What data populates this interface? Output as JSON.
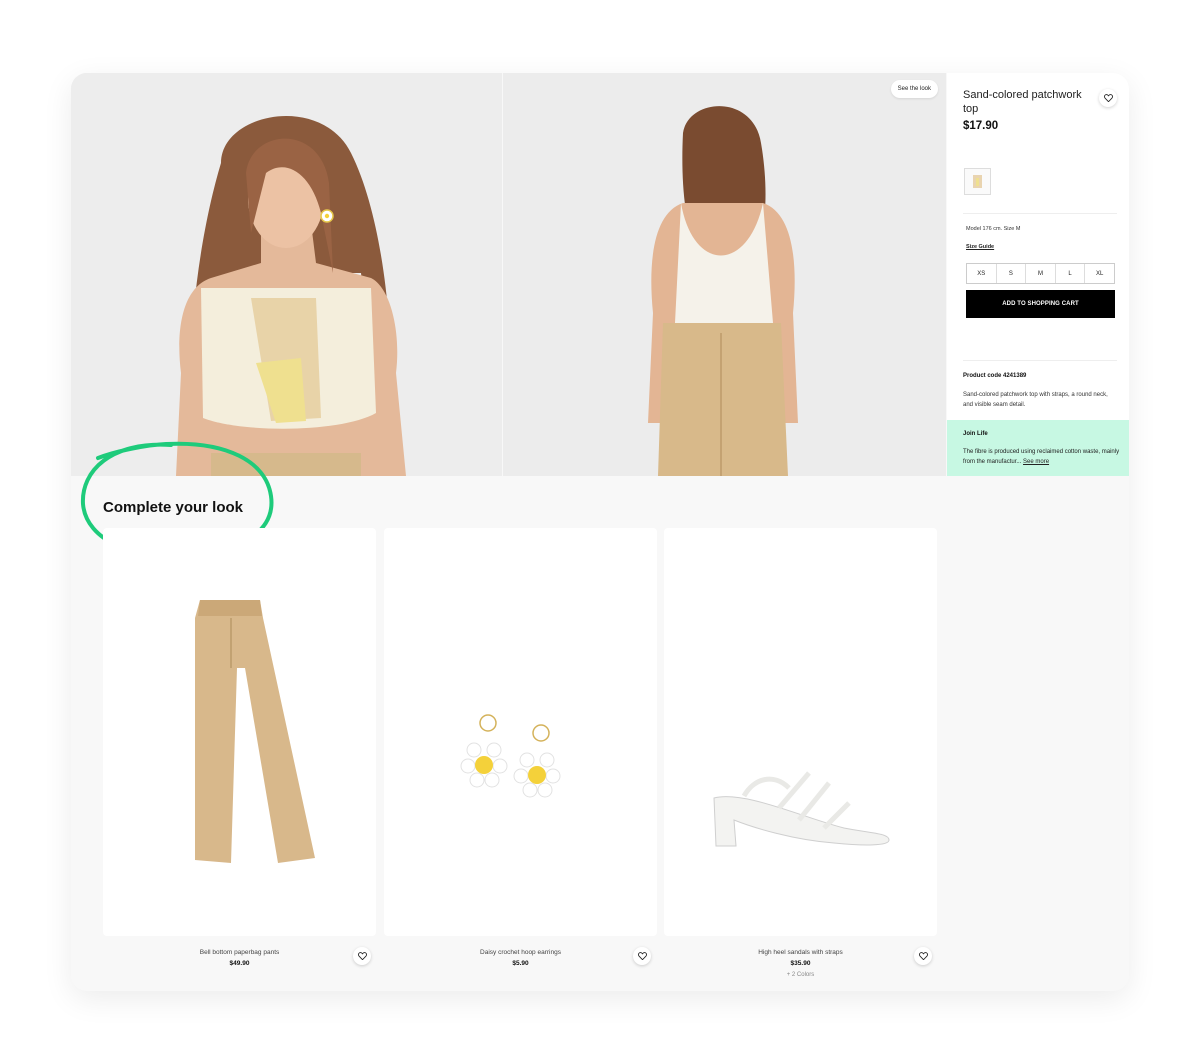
{
  "hero": {
    "see_the_look": "See the look"
  },
  "product": {
    "title": "Sand-colored patchwork top",
    "price": "$17.90",
    "model_info": "Model 176 cm. Size M",
    "size_guide": "Size Guide",
    "sizes": [
      "XS",
      "S",
      "M",
      "L",
      "XL"
    ],
    "add_to_cart": "ADD TO SHOPPING CART",
    "code": "Product code 4241389",
    "description": "Sand-colored patchwork top with straps, a round neck, and visible seam detail.",
    "join_life": {
      "title": "Join Life",
      "text": "The fibre is produced using reclaimed cotton waste, mainly from the manufactur...",
      "see_more": "See more"
    }
  },
  "complete_look": {
    "title": "Complete your look",
    "items": [
      {
        "name": "Bell bottom paperbag pants",
        "price": "$49.90",
        "colors": ""
      },
      {
        "name": "Daisy crochet hoop earrings",
        "price": "$5.90",
        "colors": ""
      },
      {
        "name": "High heel sandals with straps",
        "price": "$35.90",
        "colors": "+ 2 Colors"
      }
    ]
  },
  "colors": {
    "accent_green": "#1ecb7b",
    "join_life_bg": "#c7f8e3",
    "button_black": "#000000"
  }
}
